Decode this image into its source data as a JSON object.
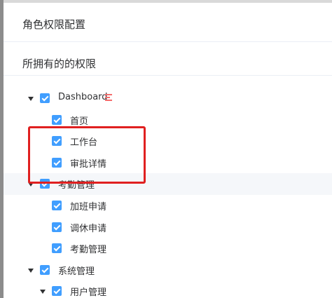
{
  "dialog": {
    "title": "角色权限配置"
  },
  "section": {
    "title": "所拥有的的权限"
  },
  "tree": {
    "dashboard": {
      "label": "Dashboard",
      "icon": "menu-icon",
      "checked": true,
      "expanded": true
    },
    "home": {
      "label": "首页",
      "checked": true
    },
    "workbench": {
      "label": "工作台",
      "checked": true
    },
    "approval_detail": {
      "label": "审批详情",
      "checked": true
    },
    "attendance": {
      "label": "考勤管理",
      "checked": true,
      "expanded": true
    },
    "overtime_request": {
      "label": "加班申请",
      "checked": true
    },
    "leave_request": {
      "label": "调休申请",
      "checked": true
    },
    "attendance_manage": {
      "label": "考勤管理",
      "checked": true
    },
    "system": {
      "label": "系统管理",
      "checked": true,
      "expanded": true
    },
    "user_manage": {
      "label": "用户管理",
      "checked": true,
      "expanded": true
    }
  },
  "colors": {
    "checkbox": "#409eff",
    "annotation": "#e02020",
    "menu_icon": "#f56c6c"
  }
}
